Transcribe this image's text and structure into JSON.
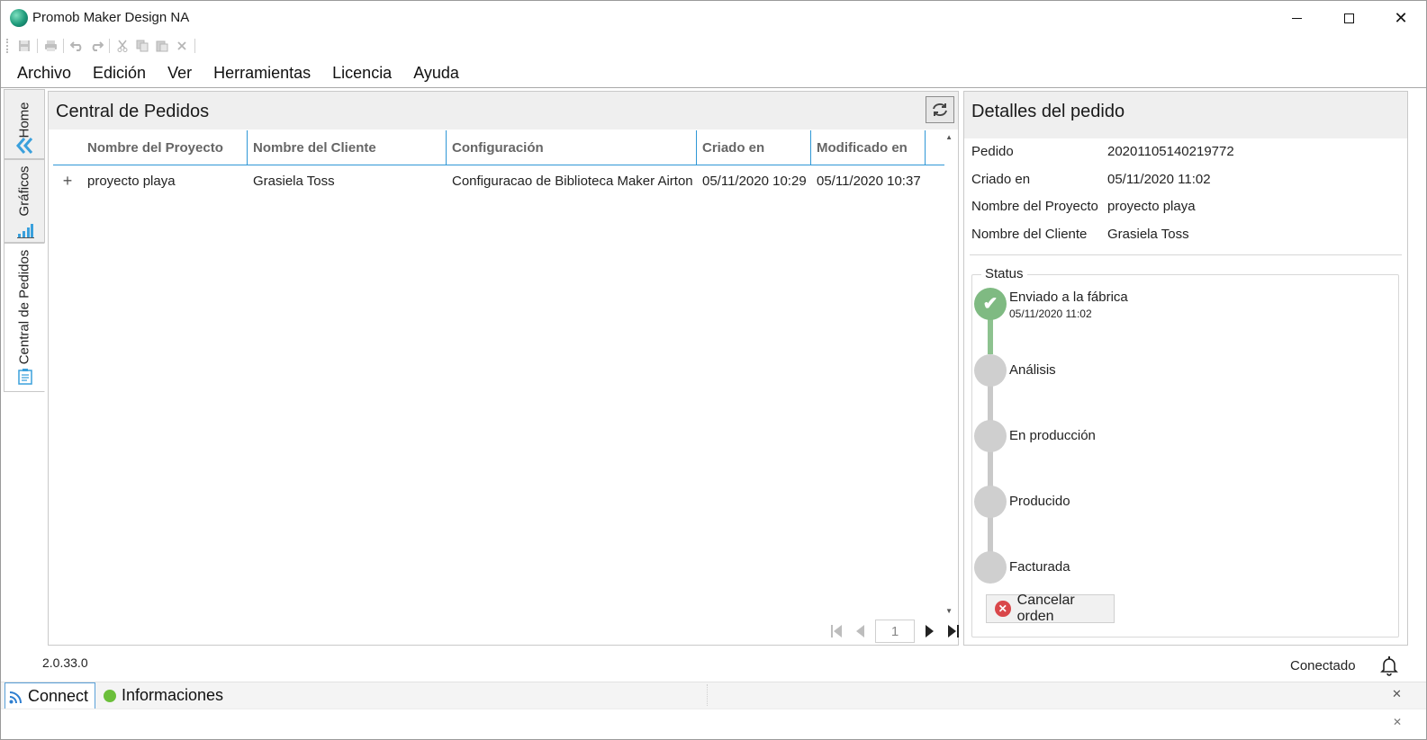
{
  "window": {
    "title": "Promob Maker Design NA",
    "minimize_icon": "minimize-icon",
    "maximize_icon": "maximize-icon",
    "close_icon": "close-icon"
  },
  "toolbar": {
    "icons": [
      "save-icon",
      "print-icon",
      "undo-icon",
      "redo-icon",
      "cut-icon",
      "copy-icon",
      "paste-icon",
      "delete-icon"
    ]
  },
  "menu": {
    "items": [
      "Archivo",
      "Edición",
      "Ver",
      "Herramientas",
      "Licencia",
      "Ayuda"
    ]
  },
  "left_tabs": {
    "home": "Home",
    "graficos": "Gráficos",
    "central": "Central de Pedidos"
  },
  "main": {
    "title": "Central de Pedidos",
    "refresh_icon": "refresh-icon",
    "columns": [
      "Nombre del Proyecto",
      "Nombre del Cliente",
      "Configuración",
      "Criado en",
      "Modificado en"
    ],
    "rows": [
      {
        "expander": "+",
        "proyecto": "proyecto playa",
        "cliente": "Grasiela Toss",
        "configuracion": "Configuracao de Biblioteca Maker Airton",
        "criado": "05/11/2020 10:29",
        "modificado": "05/11/2020 10:37"
      }
    ],
    "pager": {
      "page": "1"
    }
  },
  "details": {
    "title": "Detalles del pedido",
    "fields": [
      {
        "label": "Pedido",
        "value": "20201105140219772"
      },
      {
        "label": "Criado en",
        "value": "05/11/2020 11:02"
      },
      {
        "label": "Nombre del Proyecto",
        "value": "proyecto playa"
      },
      {
        "label": "Nombre del Cliente",
        "value": "Grasiela Toss"
      }
    ],
    "status_label": "Status",
    "steps": [
      {
        "label": "Enviado a la fábrica",
        "date": "05/11/2020 11:02",
        "done": true
      },
      {
        "label": "Análisis",
        "done": false
      },
      {
        "label": "En producción",
        "done": false
      },
      {
        "label": "Producido",
        "done": false
      },
      {
        "label": "Facturada",
        "done": false
      }
    ],
    "cancel_label": "Cancelar orden"
  },
  "status_bar": {
    "version": "2.0.33.0",
    "connection": "Conectado"
  },
  "bottom_tabs": {
    "connect": "Connect",
    "info": "Informaciones"
  },
  "colors": {
    "accent_blue": "#2f97d6",
    "done_green": "#7fba82",
    "pending_grey": "#cfcfcf",
    "cancel_red": "#d9474a"
  }
}
